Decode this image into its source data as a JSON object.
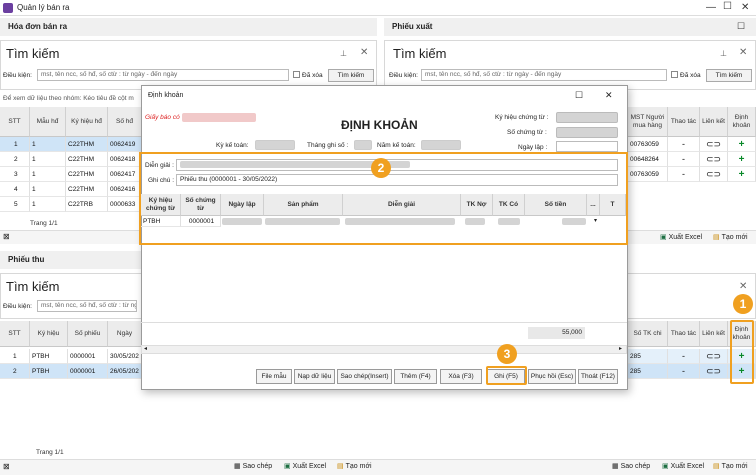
{
  "window": {
    "title": "Quản lý bán ra"
  },
  "sections": {
    "hoadon": "Hóa đơn bán ra",
    "phieuxuat": "Phiếu xuất",
    "phieuthu": "Phiếu thu"
  },
  "search": {
    "title": "Tìm kiếm",
    "condition_label": "Điều kiện:",
    "placeholder": "mst, tên ncc, số hđ, số ctừ : từ ngày - đến ngày",
    "erased_label": "Đã xóa",
    "search_button": "Tìm kiếm"
  },
  "group_hint": "Để xem dữ liệu theo nhóm: Kéo tiêu đề cột m",
  "invoice_table": {
    "headers": [
      "STT",
      "Mẫu hđ",
      "Ký hiệu hđ",
      "Số hđ"
    ],
    "rows": [
      {
        "stt": "1",
        "mau": "1",
        "kyhieu": "C22THM",
        "so": "0062419"
      },
      {
        "stt": "2",
        "mau": "1",
        "kyhieu": "C22THM",
        "so": "0062418"
      },
      {
        "stt": "3",
        "mau": "1",
        "kyhieu": "C22THM",
        "so": "0062417"
      },
      {
        "stt": "4",
        "mau": "1",
        "kyhieu": "C22THM",
        "so": "0062416"
      },
      {
        "stt": "5",
        "mau": "1",
        "kyhieu": "C22TRB",
        "so": "0000633"
      }
    ],
    "page": "Trang 1/1"
  },
  "export_table": {
    "headers": [
      "MST Người mua hàng",
      "Thao tác",
      "Liên kết",
      "Định khoản"
    ],
    "rows": [
      "00763059",
      "00648264",
      "00763059"
    ],
    "action_dash": "-"
  },
  "receipt_table": {
    "headers": [
      "STT",
      "Ký hiệu",
      "Số phiếu",
      "Ngày"
    ],
    "rows": [
      {
        "stt": "1",
        "kyhieu": "PTBH",
        "so": "0000001",
        "ngay": "30/05/202"
      },
      {
        "stt": "2",
        "kyhieu": "PTBH",
        "so": "0000001",
        "ngay": "26/05/202"
      }
    ],
    "page": "Trang 1/1"
  },
  "right_receipt": {
    "headers": [
      "Số TK chi",
      "Thao tác",
      "Liên kết",
      "Định khoản"
    ],
    "rows": [
      "285",
      "285"
    ]
  },
  "tools": {
    "copy": "Sao chép",
    "export": "Xuất Excel",
    "new": "Tạo mới"
  },
  "dialog": {
    "title": "Định khoản",
    "heading": "ĐỊNH KHOẢN",
    "notice": "Giấy báo có",
    "kyketoan": "Kỳ kế toán:",
    "thangghiso": "Tháng ghi số :",
    "namketoan": "Năm kế toán:",
    "kyhieuct": "Ký hiệu chứng từ :",
    "soct": "Số chứng từ :",
    "ngaylap": "Ngày lập :",
    "diengiai_label": "Diễn giải :",
    "ghichu_label": "Ghi chú :",
    "ghichu_value": "Phiếu thu (0000001 - 30/05/2022)",
    "grid_headers": [
      "Ký hiệu chứng từ",
      "Số chứng từ",
      "Ngày lập",
      "Sản phẩm",
      "Diễn giải",
      "TK Nợ",
      "TK Có",
      "Số tiền",
      "...",
      "T"
    ],
    "grid_row": {
      "kyhieu": "PTBH",
      "so": "0000001"
    },
    "total": "55,000",
    "buttons": [
      "File mẫu",
      "Nạp dữ liệu",
      "Sao chép(Insert)",
      "Thêm (F4)",
      "Xóa (F3)",
      "Ghi (F5)",
      "Phục hồi (Esc)",
      "Thoát (F12)"
    ]
  },
  "callouts": [
    "1",
    "2",
    "3"
  ],
  "colors": {
    "accent": "#f0a020",
    "selected": "#cfe4f7",
    "plus": "#0a8a2a"
  }
}
